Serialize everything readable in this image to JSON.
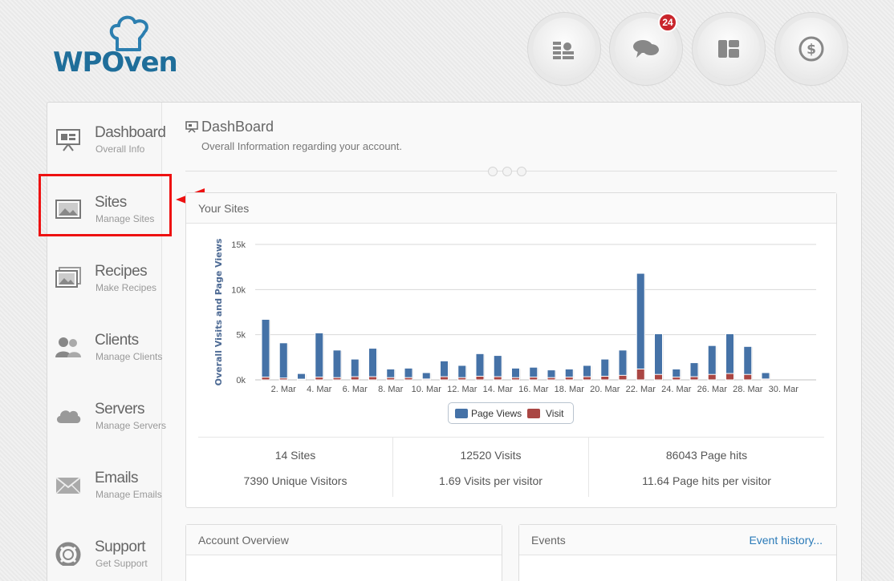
{
  "logo": {
    "text": "WPOven"
  },
  "top_icons": [
    {
      "name": "billing-icon"
    },
    {
      "name": "chat-icon",
      "badge": "24"
    },
    {
      "name": "layout-icon"
    },
    {
      "name": "dollar-icon"
    }
  ],
  "sidebar": {
    "items": [
      {
        "label": "Dashboard",
        "sub": "Overall Info",
        "icon": "presentation-icon"
      },
      {
        "label": "Sites",
        "sub": "Manage Sites",
        "icon": "image-icon"
      },
      {
        "label": "Recipes",
        "sub": "Make Recipes",
        "icon": "images-stack-icon"
      },
      {
        "label": "Clients",
        "sub": "Manage Clients",
        "icon": "users-icon"
      },
      {
        "label": "Servers",
        "sub": "Manage Servers",
        "icon": "cloud-icon"
      },
      {
        "label": "Emails",
        "sub": "Manage Emails",
        "icon": "envelope-icon"
      },
      {
        "label": "Support",
        "sub": "Get Support",
        "icon": "lifebuoy-icon"
      }
    ]
  },
  "header": {
    "title": "DashBoard",
    "subtitle": "Overall Information regarding your account."
  },
  "sites_card": {
    "title": "Your Sites"
  },
  "chart_data": {
    "type": "bar",
    "ylabel": "Overall Visits and Page Views",
    "ylim": [
      0,
      15000
    ],
    "yticks": [
      "0k",
      "5k",
      "10k",
      "15k"
    ],
    "xtick_labels": [
      "2. Mar",
      "4. Mar",
      "6. Mar",
      "8. Mar",
      "10. Mar",
      "12. Mar",
      "14. Mar",
      "16. Mar",
      "18. Mar",
      "20. Mar",
      "22. Mar",
      "24. Mar",
      "26. Mar",
      "28. Mar",
      "30. Mar"
    ],
    "categories": [
      "1",
      "2",
      "3",
      "4",
      "5",
      "6",
      "7",
      "8",
      "9",
      "10",
      "11",
      "12",
      "13",
      "14",
      "15",
      "16",
      "17",
      "18",
      "19",
      "20",
      "21",
      "22",
      "23",
      "24",
      "25",
      "26",
      "27",
      "28",
      "29",
      "30",
      "31"
    ],
    "series": [
      {
        "name": "Page Views",
        "color": "#4572a7",
        "values": [
          6700,
          4100,
          700,
          5200,
          3300,
          2300,
          3500,
          1200,
          1300,
          800,
          2100,
          1600,
          2900,
          2700,
          1300,
          1400,
          1100,
          1200,
          1600,
          2300,
          3300,
          11800,
          5100,
          1200,
          1900,
          3800,
          5100,
          3700,
          800,
          0,
          0
        ]
      },
      {
        "name": "Visit",
        "color": "#aa4643",
        "values": [
          300,
          200,
          80,
          300,
          250,
          350,
          350,
          250,
          250,
          100,
          350,
          250,
          400,
          350,
          250,
          300,
          250,
          300,
          350,
          400,
          500,
          1200,
          600,
          300,
          350,
          600,
          700,
          600,
          100,
          0,
          0
        ]
      }
    ]
  },
  "legend": {
    "page_views": "Page Views",
    "visit": "Visit"
  },
  "stats": {
    "sites": "14 Sites",
    "unique_visitors": "7390 Unique Visitors",
    "visits": "12520 Visits",
    "visits_per_visitor": "1.69 Visits per visitor",
    "page_hits": "86043 Page hits",
    "page_hits_per_visitor": "11.64 Page hits per visitor"
  },
  "account_card": {
    "title": "Account Overview"
  },
  "events_card": {
    "title": "Events",
    "link": "Event history..."
  },
  "colors": {
    "accent": "#1f6e9a",
    "highlight": "#e11111",
    "badge": "#c9252b"
  }
}
